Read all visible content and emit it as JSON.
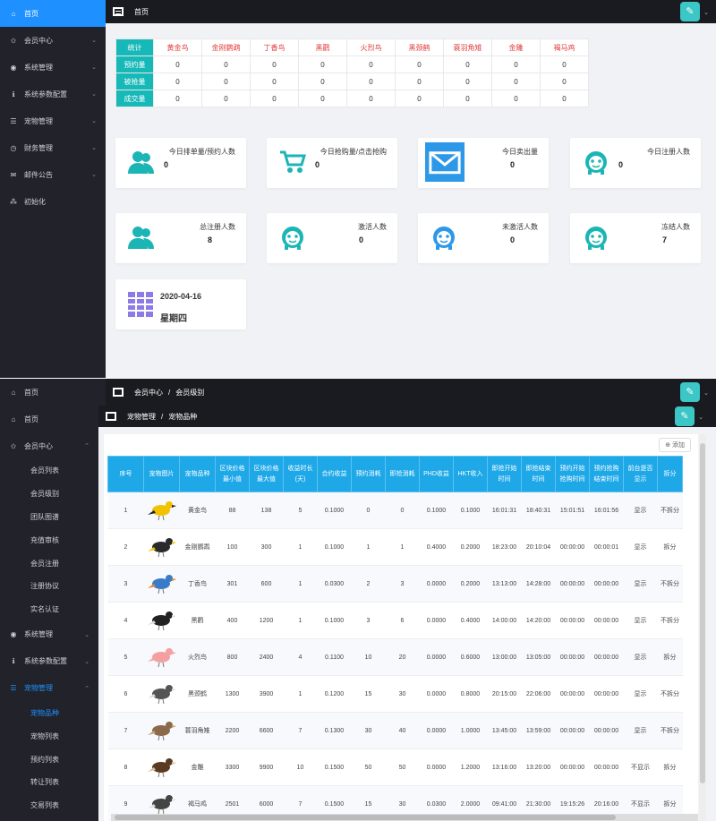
{
  "p1": {
    "sidebar": [
      {
        "icon": "home-icon",
        "label": "首页",
        "g": "⌂",
        "active": true
      },
      {
        "icon": "star-icon",
        "label": "会员中心",
        "g": "✩"
      },
      {
        "icon": "globe-icon",
        "label": "系统管理",
        "g": "◉"
      },
      {
        "icon": "info-icon",
        "label": "系统参数配置",
        "g": "ℹ"
      },
      {
        "icon": "database-icon",
        "label": "宠物管理",
        "g": "☰"
      },
      {
        "icon": "finance-icon",
        "label": "财务管理",
        "g": "◷"
      },
      {
        "icon": "mail-icon",
        "label": "邮件公告",
        "g": "✉"
      },
      {
        "icon": "reset-icon",
        "label": "初始化",
        "g": "⁂"
      }
    ],
    "breadcrumb": "首页",
    "stats": {
      "headers": [
        "统计",
        "黄金鸟",
        "金刚鹦鹉",
        "丁香鸟",
        "黑鹳",
        "火烈鸟",
        "黑颈鹤",
        "蓑羽角雉",
        "金雕",
        "褐马鸡"
      ],
      "rows": [
        {
          "label": "预约量",
          "vals": [
            "0",
            "0",
            "0",
            "0",
            "0",
            "0",
            "0",
            "0",
            "0"
          ]
        },
        {
          "label": "被抢量",
          "vals": [
            "0",
            "0",
            "0",
            "0",
            "0",
            "0",
            "0",
            "0",
            "0"
          ]
        },
        {
          "label": "成交量",
          "vals": [
            "0",
            "0",
            "0",
            "0",
            "0",
            "0",
            "0",
            "0",
            "0"
          ]
        }
      ]
    },
    "cards": [
      {
        "label": "今日排单量/预约人数",
        "value": "0",
        "icon": "users-icon"
      },
      {
        "label": "今日抢购量/点击抢购",
        "value": "0",
        "icon": "cart-icon"
      },
      {
        "label": "今日卖出量",
        "value": "0",
        "icon": "mail-icon"
      },
      {
        "label": "今日注册人数",
        "value": "0",
        "icon": "face-icon"
      },
      {
        "label": "总注册人数",
        "value": "8",
        "icon": "users-icon"
      },
      {
        "label": "激活人数",
        "value": "0",
        "icon": "face-icon"
      },
      {
        "label": "未激活人数",
        "value": "0",
        "icon": "face-icon"
      },
      {
        "label": "冻结人数",
        "value": "7",
        "icon": "face-icon"
      }
    ],
    "date": "2020-04-16",
    "weekday": "星期四"
  },
  "p2": {
    "sidebar": [
      {
        "label": "首页"
      }
    ],
    "breadcrumb_root": "会员中心",
    "breadcrumb_leaf": "会员级别"
  },
  "p3": {
    "sidebar": [
      {
        "label": "首页",
        "g": "⌂",
        "icon": "home-icon"
      },
      {
        "label": "会员中心",
        "g": "✩",
        "icon": "star-icon",
        "open": true
      },
      {
        "label": "会员列表",
        "sub": true
      },
      {
        "label": "会员级别",
        "sub": true
      },
      {
        "label": "团队图谱",
        "sub": true
      },
      {
        "label": "充值审核",
        "sub": true
      },
      {
        "label": "会员注册",
        "sub": true
      },
      {
        "label": "注册协议",
        "sub": true
      },
      {
        "label": "实名认证",
        "sub": true
      },
      {
        "label": "系统管理",
        "g": "◉",
        "icon": "globe-icon"
      },
      {
        "label": "系统参数配置",
        "g": "ℹ",
        "icon": "info-icon"
      },
      {
        "label": "宠物管理",
        "g": "☰",
        "icon": "database-icon",
        "active": true,
        "open": true
      },
      {
        "label": "宠物品种",
        "sub": true,
        "on": true
      },
      {
        "label": "宠物列表",
        "sub": true
      },
      {
        "label": "预约列表",
        "sub": true
      },
      {
        "label": "转让列表",
        "sub": true
      },
      {
        "label": "交易列表",
        "sub": true
      },
      {
        "label": "邀请列表",
        "sub": true
      }
    ],
    "breadcrumb_root": "宠物管理",
    "breadcrumb_leaf": "宠物品种",
    "add_label": "添加",
    "columns": [
      "序号",
      "宠物图片",
      "宠物品种",
      "区块价格最小值",
      "区块价格最大值",
      "收益时长(天)",
      "合约收益",
      "预约消耗",
      "即抢消耗",
      "PHD收益",
      "HKT收入",
      "即抢开始时间",
      "即抢结束时间",
      "预约开始抢购时间",
      "预约抢购结束时间",
      "前台是否显示",
      "拆分"
    ],
    "rows": [
      [
        "1",
        "黄金鸟",
        "88",
        "138",
        "5",
        "0.1000",
        "0",
        "0",
        "0.1000",
        "0.1000",
        "16:01:31",
        "18:40:31",
        "15:01:51",
        "16:01:56",
        "显示",
        "不拆分"
      ],
      [
        "2",
        "金刚鹦鹉",
        "100",
        "300",
        "1",
        "0.1000",
        "1",
        "1",
        "0.4000",
        "0.2000",
        "18:23:00",
        "20:10:04",
        "00:00:00",
        "00:00:01",
        "显示",
        "拆分"
      ],
      [
        "3",
        "丁香鸟",
        "301",
        "600",
        "1",
        "0.0300",
        "2",
        "3",
        "0.0000",
        "0.2000",
        "13:13:00",
        "14:28:00",
        "00:00:00",
        "00:00:00",
        "显示",
        "不拆分"
      ],
      [
        "4",
        "黑鹳",
        "400",
        "1200",
        "1",
        "0.1000",
        "3",
        "6",
        "0.0000",
        "0.4000",
        "14:00:00",
        "14:20:00",
        "00:00:00",
        "00:00:00",
        "显示",
        "不拆分"
      ],
      [
        "5",
        "火烈鸟",
        "800",
        "2400",
        "4",
        "0.1100",
        "10",
        "20",
        "0.0000",
        "0.6000",
        "13:00:00",
        "13:05:00",
        "00:00:00",
        "00:00:00",
        "显示",
        "拆分"
      ],
      [
        "6",
        "黑颈鹤",
        "1300",
        "3900",
        "1",
        "0.1200",
        "15",
        "30",
        "0.0000",
        "0.8000",
        "20:15:00",
        "22:06:00",
        "00:00:00",
        "00:00:00",
        "显示",
        "不拆分"
      ],
      [
        "7",
        "蓑羽角雉",
        "2200",
        "6600",
        "7",
        "0.1300",
        "30",
        "40",
        "0.0000",
        "1.0000",
        "13:45:00",
        "13:59:00",
        "00:00:00",
        "00:00:00",
        "显示",
        "不拆分"
      ],
      [
        "8",
        "金雕",
        "3300",
        "9900",
        "10",
        "0.1500",
        "50",
        "50",
        "0.0000",
        "1.2000",
        "13:16:00",
        "13:20:00",
        "00:00:00",
        "00:00:00",
        "不显示",
        "拆分"
      ],
      [
        "9",
        "褐马鸡",
        "2501",
        "6000",
        "7",
        "0.1500",
        "15",
        "30",
        "0.0300",
        "2.0000",
        "09:41:00",
        "21:30:00",
        "19:15:26",
        "20:16:00",
        "不显示",
        "拆分"
      ]
    ]
  }
}
